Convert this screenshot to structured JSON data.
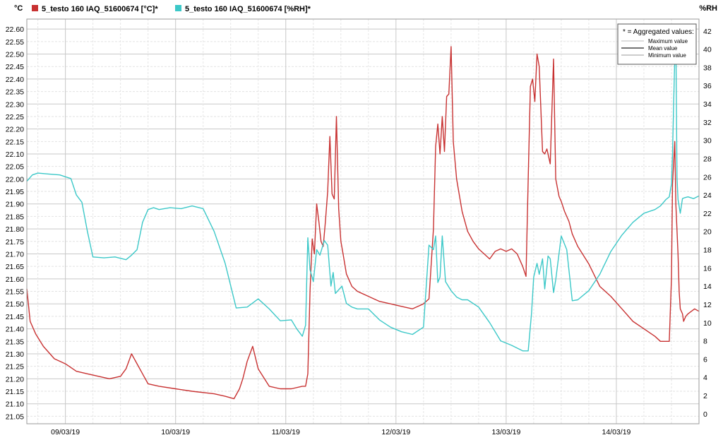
{
  "chart_data": {
    "type": "line",
    "legend": {
      "items": [
        {
          "label": "5_testo 160 IAQ_51600674 [°C]*",
          "color": "#c83232"
        },
        {
          "label": "5_testo 160 IAQ_51600674 [%RH]*",
          "color": "#3cc8c8"
        }
      ]
    },
    "y_left": {
      "unit": "°C",
      "range": [
        21.02,
        22.64
      ],
      "ticks": [
        "22.60",
        "22.55",
        "22.50",
        "22.45",
        "22.40",
        "22.35",
        "22.30",
        "22.25",
        "22.20",
        "22.15",
        "22.10",
        "22.05",
        "22.00",
        "21.95",
        "21.90",
        "21.85",
        "21.80",
        "21.75",
        "21.70",
        "21.65",
        "21.60",
        "21.55",
        "21.50",
        "21.45",
        "21.40",
        "21.35",
        "21.30",
        "21.25",
        "21.20",
        "21.15",
        "21.10",
        "21.05"
      ]
    },
    "y_right": {
      "unit": "%RH",
      "range": [
        -1.1,
        43.3
      ],
      "ticks": [
        "42",
        "40",
        "38",
        "36",
        "34",
        "32",
        "30",
        "28",
        "26",
        "24",
        "22",
        "20",
        "18",
        "16",
        "14",
        "12",
        "10",
        "8",
        "6",
        "4",
        "2",
        "0"
      ]
    },
    "x_axis": {
      "range": [
        0,
        6.1
      ],
      "tick_labels": [
        "09/03/19",
        "10/03/19",
        "11/03/19",
        "12/03/19",
        "13/03/19",
        "14/03/19"
      ],
      "tick_positions": [
        0.35,
        1.35,
        2.35,
        3.35,
        4.35,
        5.35
      ]
    },
    "grid": true,
    "aggregation_box": {
      "title": "* = Aggregated values:",
      "max_label": "Maximum value",
      "mean_label": "Mean value",
      "min_label": "Minimum value",
      "position": "top-right"
    },
    "series": [
      {
        "name": "5_testo 160 IAQ_51600674 [°C]*",
        "axis": "left",
        "color": "#c83232",
        "x": [
          0.0,
          0.03,
          0.08,
          0.15,
          0.25,
          0.35,
          0.45,
          0.55,
          0.65,
          0.75,
          0.85,
          0.9,
          0.95,
          1.0,
          1.05,
          1.1,
          1.2,
          1.35,
          1.5,
          1.7,
          1.8,
          1.88,
          1.93,
          1.96,
          2.0,
          2.05,
          2.1,
          2.2,
          2.3,
          2.4,
          2.5,
          2.53,
          2.55,
          2.57,
          2.59,
          2.61,
          2.63,
          2.65,
          2.67,
          2.69,
          2.71,
          2.73,
          2.75,
          2.77,
          2.79,
          2.81,
          2.83,
          2.85,
          2.87,
          2.9,
          2.95,
          3.0,
          3.1,
          3.2,
          3.3,
          3.4,
          3.5,
          3.6,
          3.65,
          3.69,
          3.71,
          3.73,
          3.75,
          3.77,
          3.79,
          3.81,
          3.83,
          3.85,
          3.87,
          3.9,
          3.95,
          4.0,
          4.05,
          4.1,
          4.15,
          4.2,
          4.25,
          4.3,
          4.35,
          4.4,
          4.45,
          4.5,
          4.53,
          4.55,
          4.57,
          4.59,
          4.61,
          4.63,
          4.65,
          4.68,
          4.7,
          4.72,
          4.75,
          4.78,
          4.8,
          4.83,
          4.85,
          4.88,
          4.92,
          4.95,
          5.0,
          5.1,
          5.2,
          5.3,
          5.4,
          5.5,
          5.6,
          5.7,
          5.75,
          5.8,
          5.83,
          5.85,
          5.86,
          5.88,
          5.89,
          5.91,
          5.92,
          5.93,
          5.95,
          5.96,
          5.98,
          6.0,
          6.03,
          6.06,
          6.1
        ],
        "values": [
          21.56,
          21.43,
          21.38,
          21.33,
          21.28,
          21.26,
          21.23,
          21.22,
          21.21,
          21.2,
          21.21,
          21.24,
          21.3,
          21.26,
          21.22,
          21.18,
          21.17,
          21.16,
          21.15,
          21.14,
          21.13,
          21.12,
          21.16,
          21.2,
          21.27,
          21.33,
          21.24,
          21.17,
          21.16,
          21.16,
          21.17,
          21.17,
          21.22,
          21.55,
          21.76,
          21.7,
          21.9,
          21.83,
          21.75,
          21.73,
          21.83,
          21.95,
          22.17,
          21.94,
          21.92,
          22.25,
          21.88,
          21.75,
          21.7,
          21.62,
          21.57,
          21.55,
          21.53,
          21.51,
          21.5,
          21.49,
          21.48,
          21.5,
          21.52,
          21.8,
          22.13,
          22.22,
          22.1,
          22.25,
          22.11,
          22.33,
          22.34,
          22.53,
          22.15,
          22.0,
          21.87,
          21.79,
          21.75,
          21.72,
          21.7,
          21.68,
          21.71,
          21.72,
          21.71,
          21.72,
          21.7,
          21.65,
          21.61,
          22.0,
          22.37,
          22.4,
          22.31,
          22.5,
          22.45,
          22.11,
          22.1,
          22.12,
          22.06,
          22.48,
          22.0,
          21.93,
          21.91,
          21.87,
          21.83,
          21.78,
          21.73,
          21.66,
          21.57,
          21.53,
          21.48,
          21.43,
          21.4,
          21.37,
          21.35,
          21.35,
          21.35,
          21.6,
          21.98,
          22.15,
          21.9,
          21.7,
          21.55,
          21.48,
          21.46,
          21.43,
          21.45,
          21.46,
          21.47,
          21.48,
          21.47
        ]
      },
      {
        "name": "5_testo 160 IAQ_51600674 [%RH]*",
        "axis": "right",
        "color": "#3cc8c8",
        "x": [
          0.0,
          0.05,
          0.1,
          0.2,
          0.3,
          0.35,
          0.4,
          0.45,
          0.5,
          0.55,
          0.6,
          0.7,
          0.8,
          0.9,
          0.95,
          1.0,
          1.05,
          1.1,
          1.15,
          1.2,
          1.3,
          1.4,
          1.5,
          1.6,
          1.7,
          1.8,
          1.9,
          2.0,
          2.1,
          2.2,
          2.3,
          2.4,
          2.45,
          2.5,
          2.53,
          2.55,
          2.57,
          2.6,
          2.63,
          2.66,
          2.7,
          2.73,
          2.76,
          2.78,
          2.8,
          2.83,
          2.86,
          2.9,
          2.95,
          3.0,
          3.1,
          3.2,
          3.3,
          3.4,
          3.5,
          3.6,
          3.65,
          3.69,
          3.71,
          3.73,
          3.75,
          3.77,
          3.8,
          3.85,
          3.9,
          3.95,
          4.0,
          4.1,
          4.2,
          4.3,
          4.4,
          4.5,
          4.55,
          4.58,
          4.6,
          4.63,
          4.65,
          4.68,
          4.7,
          4.73,
          4.75,
          4.78,
          4.8,
          4.85,
          4.9,
          4.95,
          5.0,
          5.1,
          5.2,
          5.3,
          5.4,
          5.5,
          5.6,
          5.7,
          5.75,
          5.8,
          5.83,
          5.85,
          5.86,
          5.87,
          5.88,
          5.89,
          5.9,
          5.91,
          5.93,
          5.95,
          5.97,
          6.0,
          6.05,
          6.1
        ],
        "values": [
          25.5,
          26.2,
          26.4,
          26.3,
          26.2,
          26.0,
          25.8,
          24.0,
          23.2,
          20.0,
          17.2,
          17.1,
          17.2,
          16.9,
          17.4,
          18.0,
          21.0,
          22.4,
          22.6,
          22.4,
          22.6,
          22.5,
          22.8,
          22.5,
          20.0,
          16.5,
          11.6,
          11.7,
          12.6,
          11.5,
          10.2,
          10.3,
          9.3,
          8.5,
          9.7,
          19.3,
          15.8,
          14.5,
          18.0,
          17.4,
          19.0,
          18.5,
          14.0,
          15.5,
          13.2,
          13.6,
          14.0,
          12.1,
          11.7,
          11.5,
          11.5,
          10.3,
          9.5,
          9.0,
          8.7,
          9.5,
          18.5,
          18.0,
          19.5,
          14.4,
          15.0,
          19.5,
          14.5,
          13.5,
          12.8,
          12.5,
          12.5,
          11.7,
          10.0,
          8.0,
          7.5,
          6.9,
          6.9,
          11.0,
          15.0,
          16.5,
          15.3,
          17.0,
          13.7,
          17.3,
          17.0,
          13.3,
          14.7,
          19.5,
          18.0,
          12.4,
          12.5,
          13.5,
          15.3,
          17.8,
          19.6,
          21.0,
          22.0,
          22.4,
          22.8,
          23.5,
          23.8,
          25.2,
          28.5,
          34.0,
          39.0,
          42.0,
          26.0,
          23.5,
          22.0,
          23.6,
          23.7,
          23.8,
          23.6,
          23.9
        ]
      }
    ]
  }
}
